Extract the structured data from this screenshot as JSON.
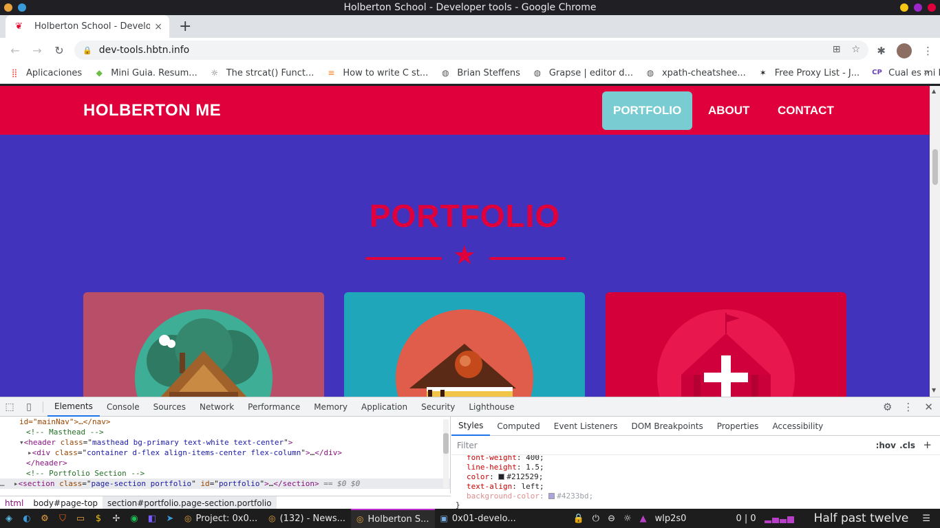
{
  "window": {
    "title": "Holberton School - Developer tools - Google Chrome"
  },
  "tab": {
    "title": "Holberton School - Develope",
    "close": "×",
    "new_tab": "+"
  },
  "address": {
    "url": "dev-tools.hbtn.info"
  },
  "bookmarks": [
    {
      "label": "Aplicaciones",
      "icon": "apps-grid-icon"
    },
    {
      "label": "Mini Guia. Resum...",
      "icon": "leaf-icon"
    },
    {
      "label": "The strcat() Funct...",
      "icon": "bulb-icon"
    },
    {
      "label": "How to write C st...",
      "icon": "stack-icon"
    },
    {
      "label": "Brian Steffens",
      "icon": "globe-icon"
    },
    {
      "label": "Grapse | editor d...",
      "icon": "globe-icon"
    },
    {
      "label": "xpath-cheatshee...",
      "icon": "globe-icon"
    },
    {
      "label": "Free Proxy List - J...",
      "icon": "pin-icon"
    },
    {
      "label": "Cual es mi IP, Mi I...",
      "icon": "ip-icon"
    }
  ],
  "site": {
    "brand": "HOLBERTON ME",
    "nav": [
      "PORTFOLIO",
      "ABOUT",
      "CONTACT"
    ],
    "section_title": "PORTFOLIO",
    "colors": {
      "nav_bg": "#e0003b",
      "section_bg": "#4233bd",
      "active_link": "#79ccd1",
      "card1": "#b84e67",
      "card2": "#1fa6bb",
      "card3": "#d4003a"
    }
  },
  "devtools": {
    "tabs": [
      "Elements",
      "Console",
      "Sources",
      "Network",
      "Performance",
      "Memory",
      "Application",
      "Security",
      "Lighthouse"
    ],
    "active_tab": "Elements",
    "elements_lines": {
      "l0": "id=\"mainNav\">…</nav>",
      "l1": "<!-- Masthead -->",
      "l2_tag": "header",
      "l2_class": "masthead bg-primary text-white text-center",
      "l3_tag": "div",
      "l3_class": "container d-flex align-items-center flex-column",
      "l4": "</header>",
      "l5": "<!-- Portfolio Section -->",
      "l6_tag": "section",
      "l6_class": "page-section portfolio",
      "l6_id": "portfolio",
      "l6_suffix": "== $0"
    },
    "breadcrumbs": [
      "html",
      "body#page-top",
      "section#portfolio.page-section.portfolio"
    ],
    "styles_tabs": [
      "Styles",
      "Computed",
      "Event Listeners",
      "DOM Breakpoints",
      "Properties",
      "Accessibility"
    ],
    "filter_placeholder": "Filter",
    "hov": ":hov",
    "cls": ".cls",
    "css_props": [
      {
        "name": "font-weight",
        "value": "400;"
      },
      {
        "name": "line-height",
        "value": "1.5;"
      },
      {
        "name": "color",
        "value": "#212529;",
        "swatch": "#212529"
      },
      {
        "name": "text-align",
        "value": "left;"
      },
      {
        "name": "background-color",
        "value": "#4233bd;",
        "swatch": "#a9a3e0",
        "struck": true
      }
    ],
    "closing_brace": "}"
  },
  "taskbar": {
    "tasks": [
      {
        "label": "Project: 0x0...",
        "icon": "chrome-icon"
      },
      {
        "label": "(132) - News...",
        "icon": "chrome-icon"
      },
      {
        "label": "Holberton S...",
        "icon": "chrome-icon",
        "active": true
      },
      {
        "label": "0x01-develo...",
        "icon": "terminal-icon"
      }
    ],
    "net_label": "wlp2s0",
    "net_rate": "0 | 0",
    "clock": "Half past twelve"
  }
}
